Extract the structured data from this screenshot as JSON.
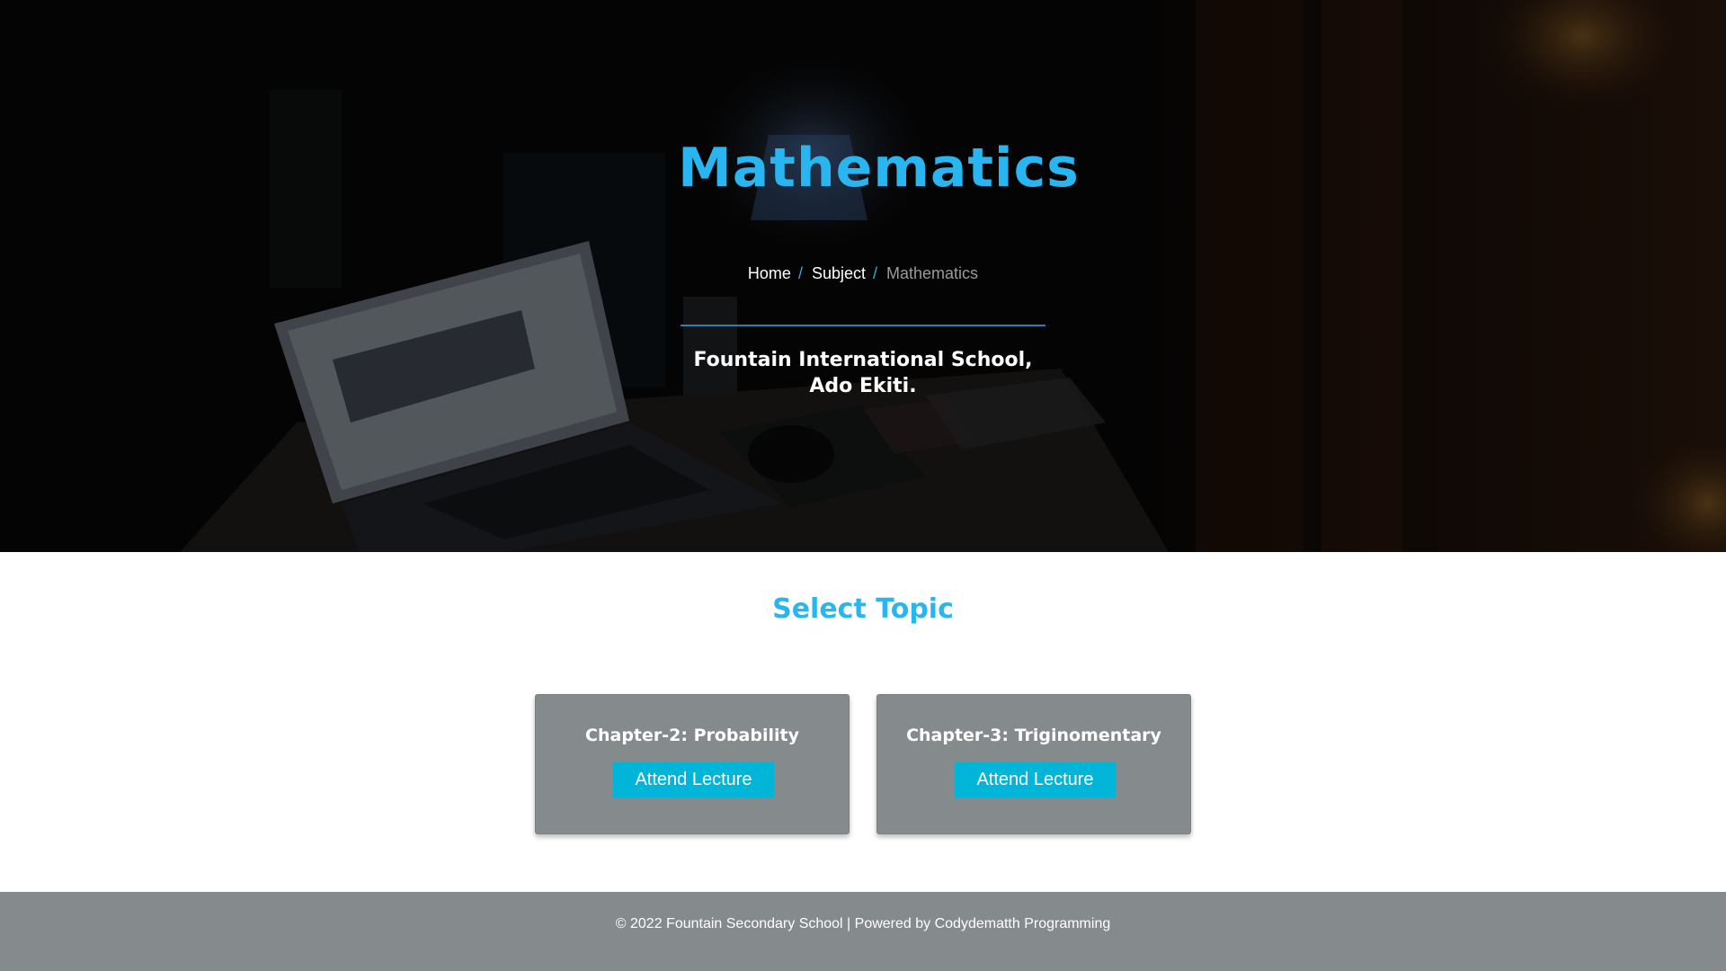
{
  "hero": {
    "title": "Mathematics",
    "breadcrumb": {
      "home": "Home",
      "separator": "/",
      "subject": "Subject",
      "current": "Mathematics"
    },
    "school_line_1": "Fountain International School,",
    "school_line_2": "Ado Ekiti."
  },
  "topics": {
    "heading": "Select Topic",
    "cards": [
      {
        "title": "Chapter-2: Probability",
        "button_label": "Attend Lecture"
      },
      {
        "title": "Chapter-3: Triginomentary",
        "button_label": "Attend Lecture"
      }
    ]
  },
  "footer": {
    "text": "© 2022 Fountain Secondary School | Powered by Codydematth Programming"
  },
  "colors": {
    "accent": "#29b6f0",
    "button": "#00b5d8",
    "card": "#858a8c",
    "footer": "#858a8c"
  }
}
